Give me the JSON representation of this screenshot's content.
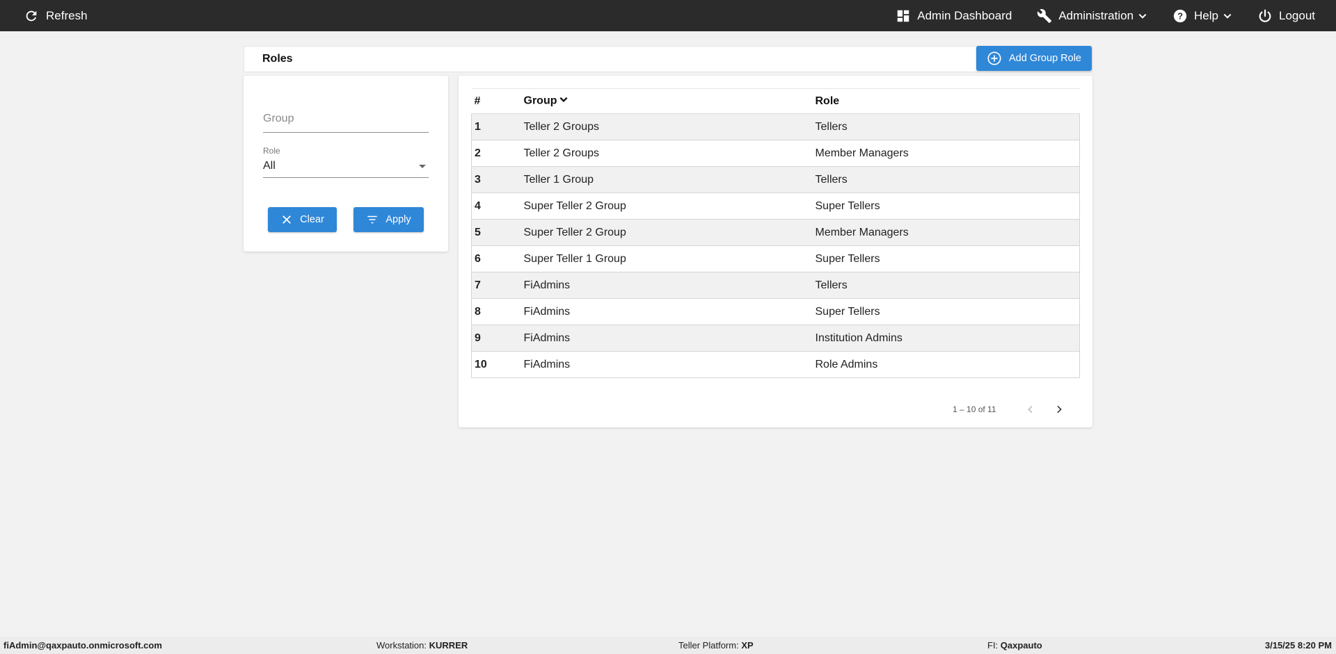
{
  "topbar": {
    "refresh_label": "Refresh",
    "nav": [
      {
        "label": "Admin Dashboard",
        "icon": "dashboard-icon"
      },
      {
        "label": "Administration",
        "icon": "wrench-icon",
        "dropdown": true
      },
      {
        "label": "Help",
        "icon": "help-icon",
        "dropdown": true
      },
      {
        "label": "Logout",
        "icon": "power-icon"
      }
    ]
  },
  "header": {
    "title": "Roles",
    "add_button_label": "Add Group Role"
  },
  "filters": {
    "group_placeholder": "Group",
    "group_value": "",
    "role_label": "Role",
    "role_value": "All",
    "clear_label": "Clear",
    "apply_label": "Apply"
  },
  "table": {
    "columns": [
      "#",
      "Group",
      "Role"
    ],
    "rows": [
      {
        "num": "1",
        "group": "Teller 2 Groups",
        "role": "Tellers"
      },
      {
        "num": "2",
        "group": "Teller 2 Groups",
        "role": "Member Managers"
      },
      {
        "num": "3",
        "group": "Teller 1 Group",
        "role": "Tellers"
      },
      {
        "num": "4",
        "group": "Super Teller 2 Group",
        "role": "Super Tellers"
      },
      {
        "num": "5",
        "group": "Super Teller 2 Group",
        "role": "Member Managers"
      },
      {
        "num": "6",
        "group": "Super Teller 1 Group",
        "role": "Super Tellers"
      },
      {
        "num": "7",
        "group": "FiAdmins",
        "role": "Tellers"
      },
      {
        "num": "8",
        "group": "FiAdmins",
        "role": "Super Tellers"
      },
      {
        "num": "9",
        "group": "FiAdmins",
        "role": "Institution Admins"
      },
      {
        "num": "10",
        "group": "FiAdmins",
        "role": "Role Admins"
      }
    ],
    "pagination": "1 – 10 of 11"
  },
  "footer": {
    "user": "fiAdmin@qaxpauto.onmicrosoft.com",
    "workstation_label": "Workstation:",
    "workstation_value": "KURRER",
    "platform_label": "Teller Platform:",
    "platform_value": "XP",
    "fi_label": "FI:",
    "fi_value": "Qaxpauto",
    "datetime": "3/15/25 8:20 PM"
  },
  "colors": {
    "topbar": "#2b2b2b",
    "accent": "#2f87d8",
    "background": "#f2f2f2"
  }
}
